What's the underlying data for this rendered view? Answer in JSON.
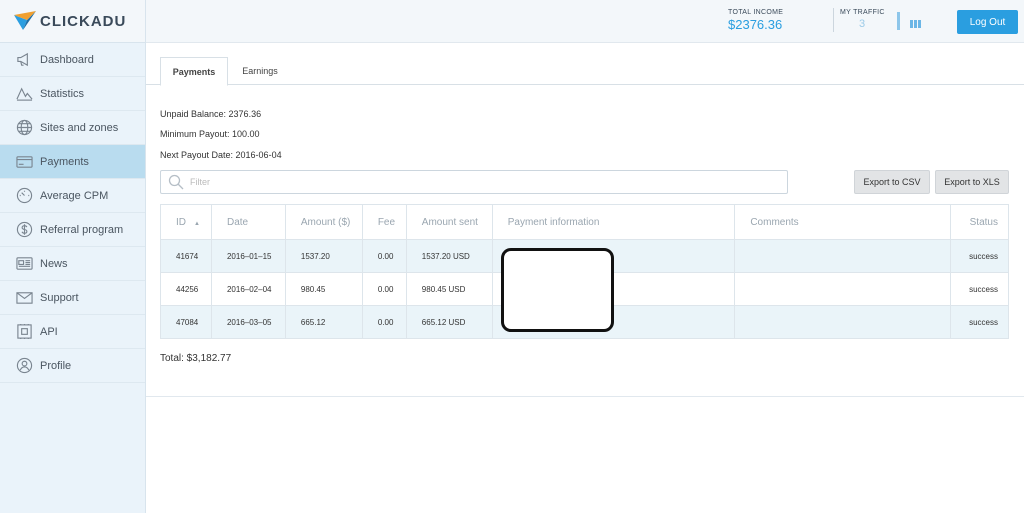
{
  "app": {
    "logo_text": "CLICKADU"
  },
  "sidebar": {
    "items": [
      {
        "label": "Dashboard",
        "icon": "megaphone-icon"
      },
      {
        "label": "Statistics",
        "icon": "chart-line-icon"
      },
      {
        "label": "Sites and zones",
        "icon": "globe-icon"
      },
      {
        "label": "Payments",
        "icon": "card-icon",
        "active": true
      },
      {
        "label": "Average CPM",
        "icon": "gauge-icon"
      },
      {
        "label": "Referral program",
        "icon": "dollar-icon"
      },
      {
        "label": "News",
        "icon": "newspaper-icon"
      },
      {
        "label": "Support",
        "icon": "envelope-icon"
      },
      {
        "label": "API",
        "icon": "api-icon"
      },
      {
        "label": "Profile",
        "icon": "user-icon"
      }
    ]
  },
  "header": {
    "income_label": "TOTAL INCOME",
    "income_value": "$2376.36",
    "traffic_label": "MY TRAFFIC",
    "traffic_value": "3",
    "logout_label": "Log Out"
  },
  "tabs": {
    "payments": "Payments",
    "earnings": "Earnings"
  },
  "summary": {
    "unpaid": "Unpaid Balance: 2376.36",
    "minimum": "Minimum Payout: 100.00",
    "next_date": "Next Payout Date: 2016-06-04"
  },
  "filter": {
    "placeholder": "Filter"
  },
  "export": {
    "csv": "Export to CSV",
    "xls": "Export to XLS"
  },
  "table": {
    "columns": [
      "ID",
      "Date",
      "Amount ($)",
      "Fee",
      "Amount sent",
      "Payment information",
      "Comments",
      "Status"
    ],
    "rows": [
      {
        "id": "41674",
        "date": "2016–01–15",
        "amount": "1537.20",
        "fee": "0.00",
        "sent": "1537.20 USD",
        "info": "",
        "comments": "",
        "status": "success"
      },
      {
        "id": "44256",
        "date": "2016–02–04",
        "amount": "980.45",
        "fee": "0.00",
        "sent": "980.45 USD",
        "info": "",
        "comments": "",
        "status": "success"
      },
      {
        "id": "47084",
        "date": "2016–03–05",
        "amount": "665.12",
        "fee": "0.00",
        "sent": "665.12 USD",
        "info": "",
        "comments": "",
        "status": "success"
      }
    ]
  },
  "total": "Total: $3,182.77",
  "colors": {
    "accent": "#2a9ee0",
    "sidebar_bg": "#eaf3fa",
    "active_bg": "#b9dcef"
  }
}
